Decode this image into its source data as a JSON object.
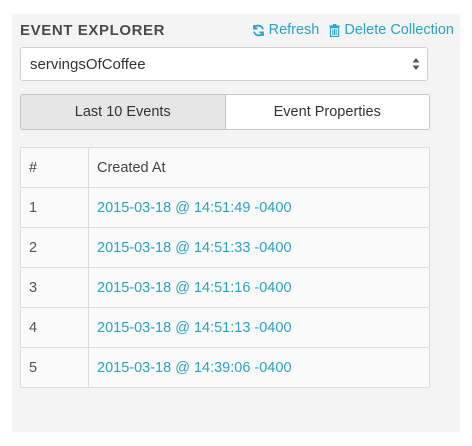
{
  "header": {
    "title": "EVENT EXPLORER",
    "refresh_label": "Refresh",
    "delete_label": "Delete Collection"
  },
  "collection_select": {
    "value": "servingsOfCoffee"
  },
  "tabs": [
    {
      "label": "Last 10 Events",
      "active": true
    },
    {
      "label": "Event Properties",
      "active": false
    }
  ],
  "table": {
    "columns": [
      "#",
      "Created At"
    ],
    "rows": [
      {
        "index": "1",
        "created_at": "2015-03-18 @ 14:51:49 -0400"
      },
      {
        "index": "2",
        "created_at": "2015-03-18 @ 14:51:33 -0400"
      },
      {
        "index": "3",
        "created_at": "2015-03-18 @ 14:51:16 -0400"
      },
      {
        "index": "4",
        "created_at": "2015-03-18 @ 14:51:13 -0400"
      },
      {
        "index": "5",
        "created_at": "2015-03-18 @ 14:39:06 -0400"
      }
    ]
  },
  "colors": {
    "accent": "#2aa3c8",
    "panel_bg": "#f4f4f4"
  },
  "icons": {
    "refresh": "refresh-icon",
    "delete": "trash-icon",
    "select": "select-arrows-icon"
  }
}
